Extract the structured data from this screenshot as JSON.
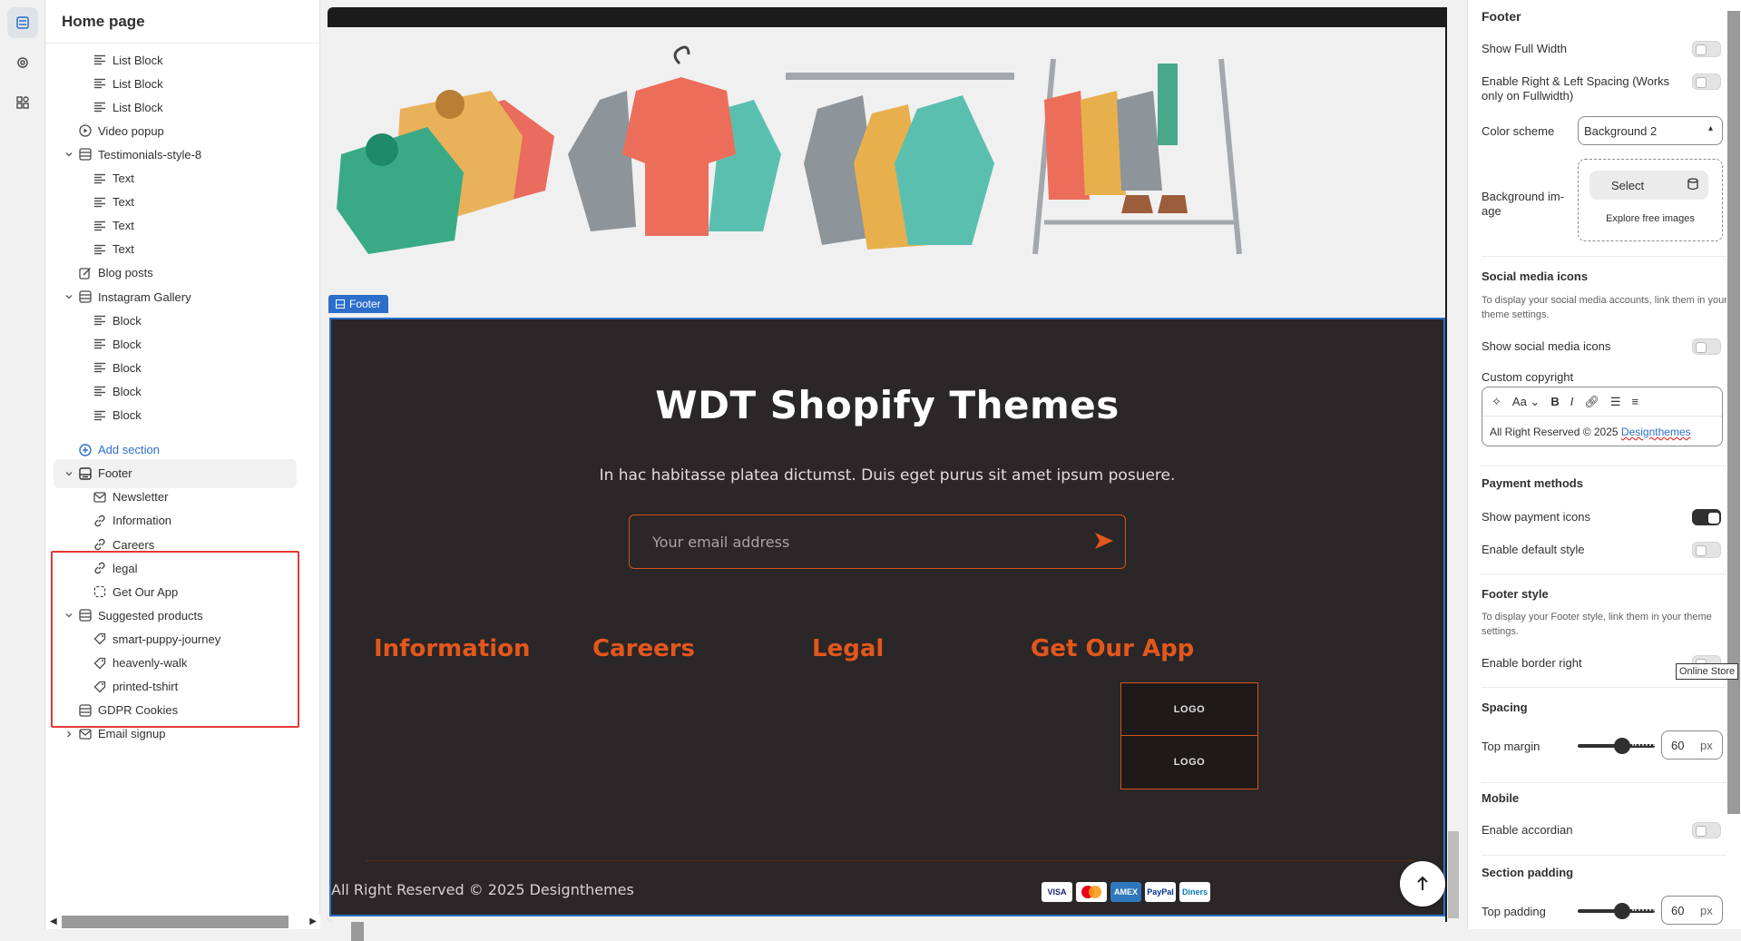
{
  "left_panel": {
    "title": "Home page",
    "tree": [
      {
        "label": "List Block",
        "icon": "text-block-icon",
        "level": 2
      },
      {
        "label": "List Block",
        "icon": "text-block-icon",
        "level": 2
      },
      {
        "label": "List Block",
        "icon": "text-block-icon",
        "level": 2
      },
      {
        "label": "Video popup",
        "icon": "play-icon",
        "level": 1
      },
      {
        "label": "Testimonials-style-8",
        "icon": "section-icon",
        "level": 1,
        "expanded": true
      },
      {
        "label": "Text",
        "icon": "text-block-icon",
        "level": 2
      },
      {
        "label": "Text",
        "icon": "text-block-icon",
        "level": 2
      },
      {
        "label": "Text",
        "icon": "text-block-icon",
        "level": 2
      },
      {
        "label": "Text",
        "icon": "text-block-icon",
        "level": 2
      },
      {
        "label": "Blog posts",
        "icon": "edit-icon",
        "level": 1
      },
      {
        "label": "Instagram Gallery",
        "icon": "section-icon",
        "level": 1,
        "expanded": true
      },
      {
        "label": "Block",
        "icon": "text-block-icon",
        "level": 2
      },
      {
        "label": "Block",
        "icon": "text-block-icon",
        "level": 2
      },
      {
        "label": "Block",
        "icon": "text-block-icon",
        "level": 2
      },
      {
        "label": "Block",
        "icon": "text-block-icon",
        "level": 2
      },
      {
        "label": "Block",
        "icon": "text-block-icon",
        "level": 2
      },
      {
        "label": "Add section",
        "icon": "plus-circle-icon",
        "level": 1,
        "link": true
      },
      {
        "label": "Footer",
        "icon": "footer-icon",
        "level": 1,
        "expanded": true,
        "selected": true
      },
      {
        "label": "Newsletter",
        "icon": "mail-icon",
        "level": 2
      },
      {
        "label": "Information",
        "icon": "link-icon",
        "level": 2
      },
      {
        "label": "Careers",
        "icon": "link-icon",
        "level": 2
      },
      {
        "label": "legal",
        "icon": "link-icon",
        "level": 2
      },
      {
        "label": "Get Our App",
        "icon": "dashed-square-icon",
        "level": 2
      },
      {
        "label": "Suggested products",
        "icon": "section-icon",
        "level": 1,
        "expanded": true
      },
      {
        "label": "smart-puppy-journey",
        "icon": "tag-icon",
        "level": 2
      },
      {
        "label": "heavenly-walk",
        "icon": "tag-icon",
        "level": 2
      },
      {
        "label": "printed-tshirt",
        "icon": "tag-icon",
        "level": 2
      },
      {
        "label": "GDPR Cookies",
        "icon": "section-icon",
        "level": 1
      },
      {
        "label": "Email signup",
        "icon": "mail-icon",
        "level": 1,
        "collapsed": true
      }
    ]
  },
  "preview": {
    "section_label": "Footer",
    "footer": {
      "title": "WDT Shopify Themes",
      "subtitle": "In hac habitasse platea dictumst. Duis eget purus sit amet ipsum posuere.",
      "email_placeholder": "Your email address",
      "columns": [
        "Information",
        "Careers",
        "Legal",
        "Get Our App"
      ],
      "app_buttons": [
        "LOGO",
        "LOGO"
      ],
      "copyright": "All Right Reserved © 2025 Designthemes",
      "payments": [
        "VISA",
        "MC",
        "AMEX",
        "PayPal",
        "Diners"
      ]
    }
  },
  "settings": {
    "heading": "Footer",
    "show_full_width": "Show Full Width",
    "enable_spacing": "Enable Right & Left Spacing (Works only on Fullwidth)",
    "color_scheme_label": "Color scheme",
    "color_scheme_value": "Background 2",
    "background_image_label": "Background im-age",
    "select_label": "Select",
    "explore_label": "Explore free images",
    "social_heading": "Social media icons",
    "social_desc": "To display your social media accounts, link them in your theme settings.",
    "show_social": "Show social media icons",
    "custom_copyright": "Custom copyright",
    "copyright_text": "All Right Reserved © 2025 ",
    "copyright_link": "Designthemes",
    "payment_heading": "Payment methods",
    "show_payment": "Show payment icons",
    "default_style": "Enable default style",
    "footer_style_heading": "Footer style",
    "footer_style_desc": "To display your Footer style, link them in your theme settings.",
    "border_right": "Enable border right",
    "tooltip": "Online Store",
    "spacing_heading": "Spacing",
    "top_margin": "Top margin",
    "top_margin_value": "60",
    "unit": "px",
    "mobile_heading": "Mobile",
    "enable_accordian": "Enable accordian",
    "padding_heading": "Section padding",
    "top_padding": "Top padding",
    "top_padding_value": "60"
  }
}
